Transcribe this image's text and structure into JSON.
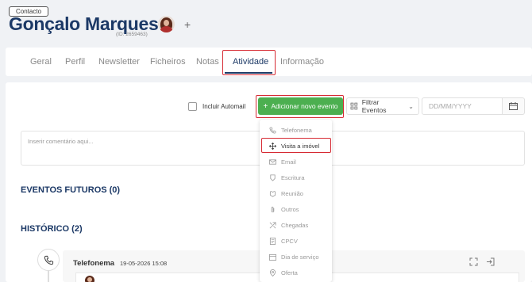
{
  "contact": {
    "badge": "Contacto",
    "name": "Gonçalo Marques",
    "id_label": "(ID: 2659463)"
  },
  "tabs": [
    {
      "label": "Geral"
    },
    {
      "label": "Perfil"
    },
    {
      "label": "Newsletter"
    },
    {
      "label": "Ficheiros"
    },
    {
      "label": "Notas"
    },
    {
      "label": "Atividade"
    },
    {
      "label": "Informação"
    }
  ],
  "active_tab": "Atividade",
  "toolbar": {
    "include_auto_label": "Incluir Automail",
    "include_auto_checked": false,
    "add_event_label": "Adicionar novo evento",
    "filter_label": "Filtrar Eventos",
    "date_placeholder": "DD/MM/YYYY"
  },
  "comment_placeholder": "Inserir comentário aqui...",
  "sections": {
    "future": "EVENTOS FUTUROS (0)",
    "history": "HISTÓRICO (2)"
  },
  "event_menu": {
    "items": [
      {
        "label": "Telefonema",
        "icon": "phone-icon"
      },
      {
        "label": "Visita a imóvel",
        "icon": "property-visit-icon"
      },
      {
        "label": "Email",
        "icon": "mail-icon"
      },
      {
        "label": "Escritura",
        "icon": "deed-icon"
      },
      {
        "label": "Reunião",
        "icon": "meeting-icon"
      },
      {
        "label": "Outros",
        "icon": "paperclip-icon"
      },
      {
        "label": "Chegadas",
        "icon": "arrivals-icon"
      },
      {
        "label": "CPCV",
        "icon": "contract-icon"
      },
      {
        "label": "Dia de serviço",
        "icon": "calendar-icon"
      },
      {
        "label": "Oferta",
        "icon": "offer-icon"
      }
    ],
    "highlighted": "Visita a imóvel"
  },
  "history_events": [
    {
      "title": "Telefonema",
      "datetime": "19-05-2026 15:08",
      "icon": "phone-icon"
    }
  ],
  "colors": {
    "brand_navy": "#1c3966",
    "accent_green": "#4caf50",
    "highlight_red": "#d62a33"
  }
}
